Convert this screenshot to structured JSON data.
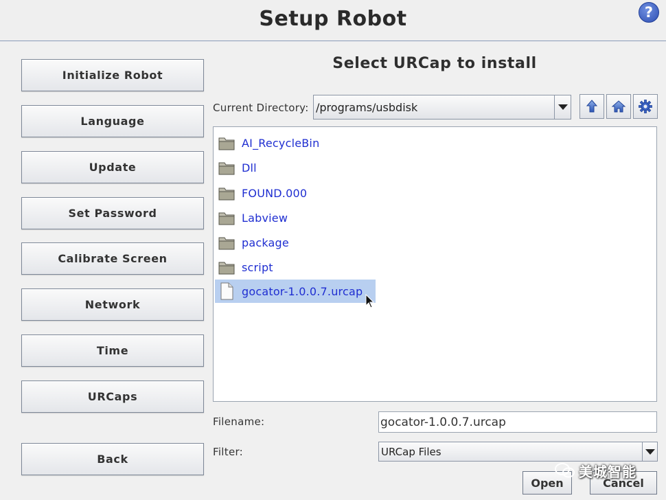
{
  "window": {
    "title": "Setup Robot",
    "help_label": "?"
  },
  "sidebar": {
    "items": [
      {
        "label": "Initialize Robot"
      },
      {
        "label": "Language"
      },
      {
        "label": "Update"
      },
      {
        "label": "Set Password"
      },
      {
        "label": "Calibrate Screen"
      },
      {
        "label": "Network"
      },
      {
        "label": "Time"
      },
      {
        "label": "URCaps"
      }
    ],
    "back_label": "Back"
  },
  "chooser": {
    "title": "Select URCap to install",
    "current_directory_label": "Current Directory:",
    "current_directory": "/programs/usbdisk",
    "toolbar_icons": [
      "up-folder-icon",
      "home-icon",
      "gear-icon"
    ],
    "files": [
      {
        "name": "AI_RecycleBin",
        "kind": "folder"
      },
      {
        "name": "Dll",
        "kind": "folder"
      },
      {
        "name": "FOUND.000",
        "kind": "folder"
      },
      {
        "name": "Labview",
        "kind": "folder"
      },
      {
        "name": "package",
        "kind": "folder"
      },
      {
        "name": "script",
        "kind": "folder"
      },
      {
        "name": "gocator-1.0.0.7.urcap",
        "kind": "file",
        "selected": true
      }
    ],
    "filename_label": "Filename:",
    "filename_value": "gocator-1.0.0.7.urcap",
    "filter_label": "Filter:",
    "filter_value": "URCap Files",
    "open_label": "Open",
    "cancel_label": "Cancel"
  },
  "watermark": {
    "text": "美城智能"
  },
  "colors": {
    "accent": "#2e4fb3",
    "link_text": "#1f2ed1",
    "selection": "#b8cff0",
    "divider": "#8a9bb8"
  }
}
